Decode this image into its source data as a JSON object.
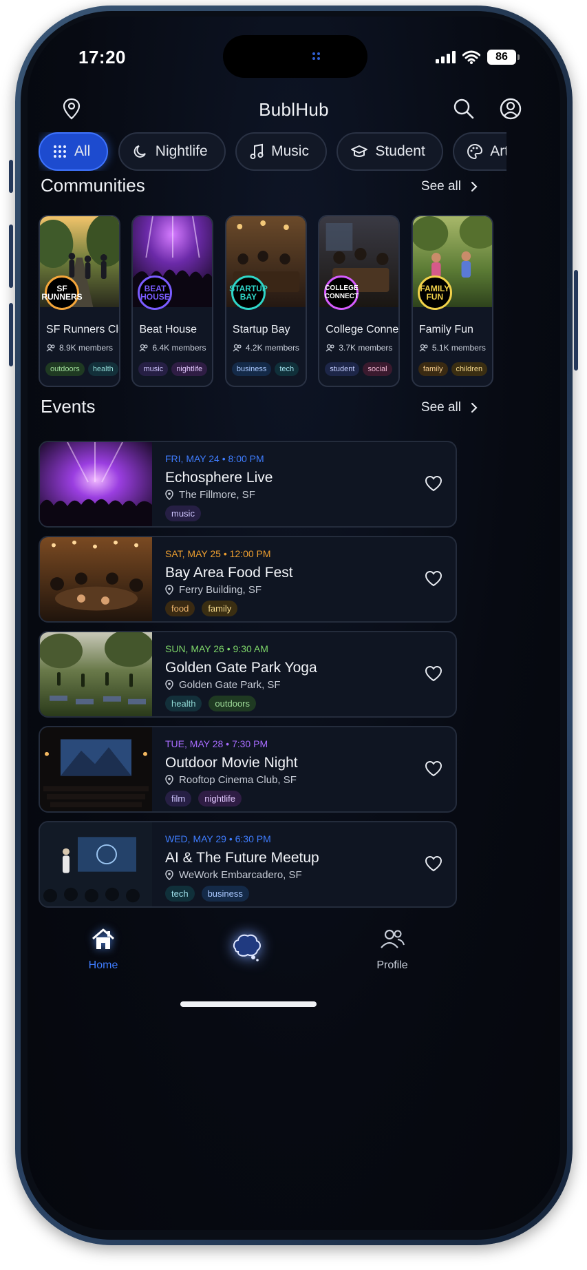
{
  "status": {
    "time": "17:20",
    "battery": "86"
  },
  "header": {
    "title": "BublHub"
  },
  "filters": [
    {
      "label": "All",
      "icon": "grid-icon",
      "active": true
    },
    {
      "label": "Nightlife",
      "icon": "moon-icon",
      "active": false
    },
    {
      "label": "Music",
      "icon": "music-note-icon",
      "active": false
    },
    {
      "label": "Student",
      "icon": "graduation-cap-icon",
      "active": false
    },
    {
      "label": "Art",
      "icon": "palette-icon",
      "active": false
    }
  ],
  "communities_section": {
    "title": "Communities",
    "see_all": "See all"
  },
  "communities": [
    {
      "name": "SF Runners Club",
      "members": "8.9K members",
      "logo": "SF RUNNERS",
      "logo_color": "#f5a63a",
      "tags": [
        {
          "label": "outdoors",
          "bg": "#1f3a22",
          "fg": "#9fdc9a"
        },
        {
          "label": "health",
          "bg": "#13303a",
          "fg": "#8fd8d4"
        }
      ]
    },
    {
      "name": "Beat House",
      "members": "6.4K members",
      "logo": "BEAT HOUSE",
      "logo_color": "#7a5cff",
      "tags": [
        {
          "label": "music",
          "bg": "#261f44",
          "fg": "#cfc6ff"
        },
        {
          "label": "nightlife",
          "bg": "#2f1d44",
          "fg": "#e3c8ff"
        }
      ]
    },
    {
      "name": "Startup Bay",
      "members": "4.2K members",
      "logo": "STARTUP BAY",
      "logo_color": "#2fd6c8",
      "tags": [
        {
          "label": "business",
          "bg": "#142a48",
          "fg": "#a9c8ff"
        },
        {
          "label": "tech",
          "bg": "#10303a",
          "fg": "#9fe1ec"
        }
      ]
    },
    {
      "name": "College Connect",
      "members": "3.7K members",
      "logo": "COLLEGE CONNECT",
      "logo_color": "#d65cff",
      "tags": [
        {
          "label": "student",
          "bg": "#1d2648",
          "fg": "#c3cdff"
        },
        {
          "label": "social",
          "bg": "#3a1a2e",
          "fg": "#f0b5d2"
        }
      ]
    },
    {
      "name": "Family Fun",
      "members": "5.1K members",
      "logo": "FAMILY FUN",
      "logo_color": "#f1d14a",
      "tags": [
        {
          "label": "family",
          "bg": "#3a2a12",
          "fg": "#f2c98a"
        },
        {
          "label": "children",
          "bg": "#3a2e12",
          "fg": "#f5d98c"
        }
      ]
    }
  ],
  "events_section": {
    "title": "Events",
    "see_all": "See all"
  },
  "events": [
    {
      "date": "FRI, MAY 24 • 8:00 PM",
      "date_color": "#3f7dff",
      "title": "Echosphere Live",
      "location": "The Fillmore, SF",
      "tags": [
        {
          "label": "music",
          "bg": "#261f44",
          "fg": "#cfc6ff"
        }
      ]
    },
    {
      "date": "SAT, MAY 25 • 12:00 PM",
      "date_color": "#f0a030",
      "title": "Bay Area Food Fest",
      "location": "Ferry Building, SF",
      "tags": [
        {
          "label": "food",
          "bg": "#3a2a12",
          "fg": "#f2b870"
        },
        {
          "label": "family",
          "bg": "#3a2e12",
          "fg": "#f5d98c"
        }
      ]
    },
    {
      "date": "SUN, MAY 26 • 9:30 AM",
      "date_color": "#7fd86a",
      "title": "Golden Gate Park Yoga",
      "location": "Golden Gate Park, SF",
      "tags": [
        {
          "label": "health",
          "bg": "#13303a",
          "fg": "#8fd8d4"
        },
        {
          "label": "outdoors",
          "bg": "#1f3a22",
          "fg": "#9fdc9a"
        }
      ]
    },
    {
      "date": "TUE, MAY 28 • 7:30 PM",
      "date_color": "#a86cff",
      "title": "Outdoor Movie Night",
      "location": "Rooftop Cinema Club, SF",
      "tags": [
        {
          "label": "film",
          "bg": "#261f44",
          "fg": "#cfc6ff"
        },
        {
          "label": "nightlife",
          "bg": "#2f1d44",
          "fg": "#e3c8ff"
        }
      ]
    },
    {
      "date": "WED, MAY 29 • 6:30 PM",
      "date_color": "#3f7dff",
      "title": "AI & The Future Meetup",
      "location": "WeWork Embarcadero, SF",
      "tags": [
        {
          "label": "tech",
          "bg": "#10303a",
          "fg": "#9fe1ec"
        },
        {
          "label": "business",
          "bg": "#142a48",
          "fg": "#a9c8ff"
        }
      ]
    }
  ],
  "tabbar": {
    "home": "Home",
    "profile": "Profile",
    "active_color": "#3f7dff"
  }
}
